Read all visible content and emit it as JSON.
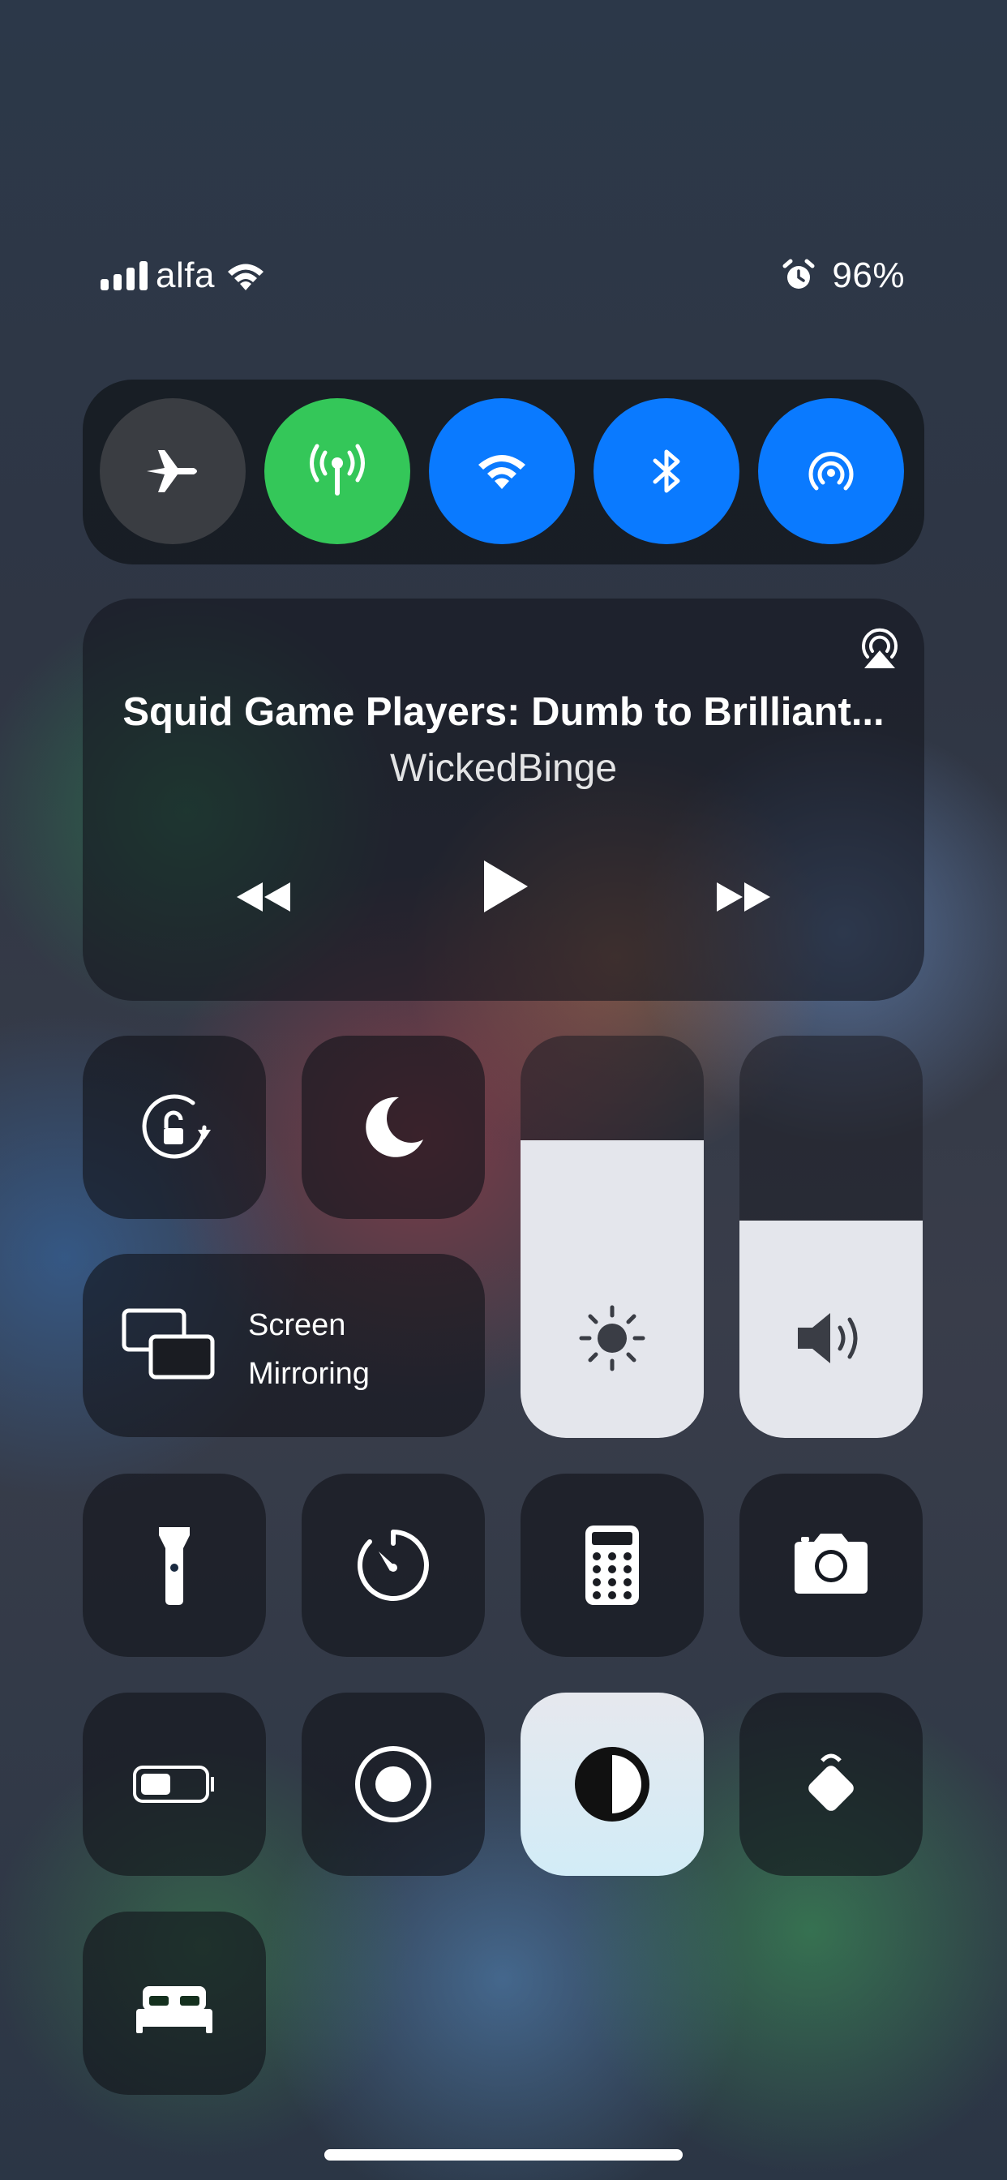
{
  "status_bar": {
    "carrier": "alfa",
    "battery": "96%"
  },
  "connectivity": {
    "airplane": {
      "icon": "airplane-icon",
      "state": "off",
      "color": "#3a3d42"
    },
    "cellular": {
      "icon": "antenna-icon",
      "state": "on",
      "color": "#34c759"
    },
    "wifi": {
      "icon": "wifi-icon",
      "state": "on",
      "color": "#0a7aff"
    },
    "bluetooth": {
      "icon": "bluetooth-icon",
      "state": "on",
      "color": "#0a7aff"
    },
    "airdrop": {
      "icon": "airdrop-icon",
      "state": "on",
      "color": "#0a7aff"
    }
  },
  "now_playing": {
    "title": "Squid Game Players: Dumb to Brilliant...",
    "artist": "WickedBinge"
  },
  "screen_mirroring": {
    "label": "Screen Mirroring"
  },
  "sliders": {
    "brightness": {
      "level": 0.74
    },
    "volume": {
      "level": 0.54
    }
  },
  "icons": [
    "rotation-lock-icon",
    "moon-icon",
    "flashlight-icon",
    "timer-icon",
    "calculator-icon",
    "camera-icon",
    "battery-icon",
    "screen-record-icon",
    "dark-mode-icon",
    "tag-icon",
    "sleep-icon"
  ]
}
